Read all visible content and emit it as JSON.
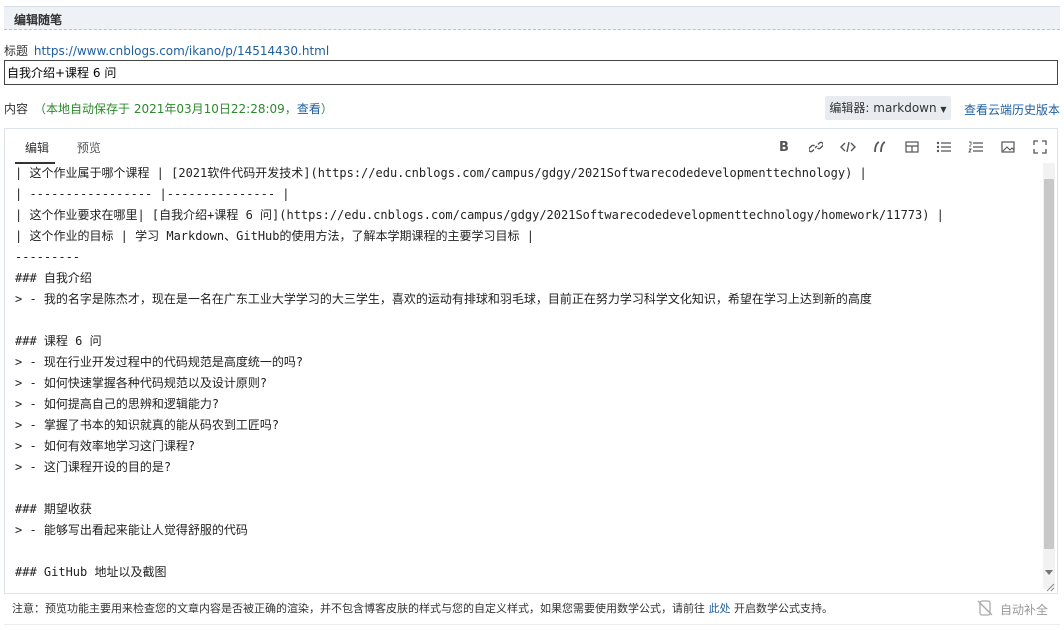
{
  "header": {
    "title": "编辑随笔"
  },
  "post": {
    "title_label": "标题",
    "url": "https://www.cnblogs.com/ikano/p/14514430.html",
    "title_value": "自我介绍+课程 6 问",
    "content_label": "内容",
    "autosave_text": "（本地自动保存于 2021年03月10日22:28:09，",
    "autosave_view": "查看",
    "autosave_close": "）"
  },
  "editor": {
    "selector_label": "编辑器: markdown",
    "history_link": "查看云端历史版本",
    "tabs": [
      {
        "label": "编辑"
      },
      {
        "label": "预览"
      }
    ],
    "toolbar": {
      "bold": "B",
      "icons": [
        "link-icon",
        "code-icon",
        "quote-icon",
        "table-icon",
        "bullet-list-icon",
        "ordered-list-icon",
        "image-icon",
        "fullscreen-icon"
      ]
    },
    "lines": [
      "| 这个作业属于哪个课程 | [2021软件代码开发技术](https://edu.cnblogs.com/campus/gdgy/2021Softwarecodedevelopmenttechnology) |",
      "| ----------------- |--------------- |",
      "| 这个作业要求在哪里| [自我介绍+课程 6 问](https://edu.cnblogs.com/campus/gdgy/2021Softwarecodedevelopmenttechnology/homework/11773) |",
      "| 这个作业的目标 | 学习 Markdown、GitHub的使用方法，了解本学期课程的主要学习目标 |",
      "---------",
      "### 自我介绍",
      "> - 我的名字是陈杰才，现在是一名在广东工业大学学习的大三学生，喜欢的运动有排球和羽毛球，目前正在努力学习科学文化知识，希望在学习上达到新的高度",
      "",
      "### 课程 6 问",
      "> - 现在行业开发过程中的代码规范是高度统一的吗?",
      "> - 如何快速掌握各种代码规范以及设计原则?",
      "> - 如何提高自己的思辨和逻辑能力?",
      "> - 掌握了书本的知识就真的能从码农到工匠吗?",
      "> - 如何有效率地学习这门课程?",
      "> - 这门课程开设的目的是?",
      "",
      "### 期望收获",
      "> - 能够写出看起来能让人觉得舒服的代码",
      "",
      "### GitHub 地址以及截图"
    ]
  },
  "footer": {
    "note_prefix": "注意：预览功能主要用来检查您的文章内容是否被正确的渲染，并不包含博客皮肤的样式与您的自定义样式，如果您需要使用数学公式，请前往",
    "note_link": "此处",
    "note_suffix": "开启数学公式支持。",
    "autocomplete_label": "自动补全"
  }
}
